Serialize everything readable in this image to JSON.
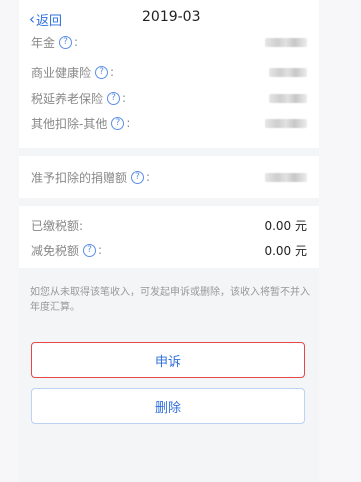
{
  "header": {
    "back_label": "返回",
    "title": "2019-03"
  },
  "deductions": {
    "partial_label": "年金",
    "items": [
      {
        "label": "商业健康险",
        "help": "?"
      },
      {
        "label": "税延养老保险",
        "help": "?"
      },
      {
        "label": "其他扣除-其他",
        "help": "?"
      }
    ]
  },
  "donation": {
    "label": "准予扣除的捐赠额",
    "help": "?"
  },
  "taxes": {
    "paid_label": "已缴税额:",
    "paid_value": "0.00 元",
    "relief_label": "减免税额",
    "relief_value": "0.00 元",
    "help": "?"
  },
  "note": "如您从未取得该笔收入，可发起申诉或删除，该收入将暂不并入年度汇算。",
  "actions": {
    "appeal_label": "申诉",
    "delete_label": "删除"
  },
  "colors": {
    "accent": "#2f6fdf",
    "appeal_border": "#e54848"
  }
}
